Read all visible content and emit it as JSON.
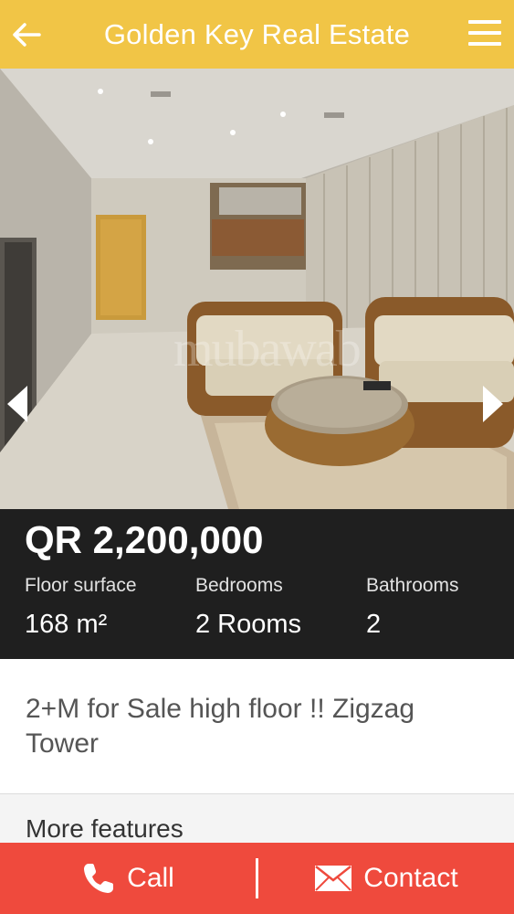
{
  "header": {
    "title": "Golden Key Real Estate",
    "back_icon": "arrow-left-icon",
    "menu_icon": "hamburger-menu-icon",
    "color": "#f1c546"
  },
  "gallery": {
    "watermark": "mubawab",
    "prev_icon": "chevron-left-icon",
    "next_icon": "chevron-right-icon"
  },
  "listing": {
    "price": "QR 2,200,000",
    "specs": [
      {
        "label": "Floor surface",
        "value": "168 m²"
      },
      {
        "label": "Bedrooms",
        "value": "2 Rooms"
      },
      {
        "label": "Bathrooms",
        "value": "2"
      }
    ],
    "description": "2+M for Sale high floor !! Zigzag Tower",
    "more_features": "More features"
  },
  "actions": {
    "call_label": "Call",
    "contact_label": "Contact",
    "color": "#ef4a3d"
  }
}
